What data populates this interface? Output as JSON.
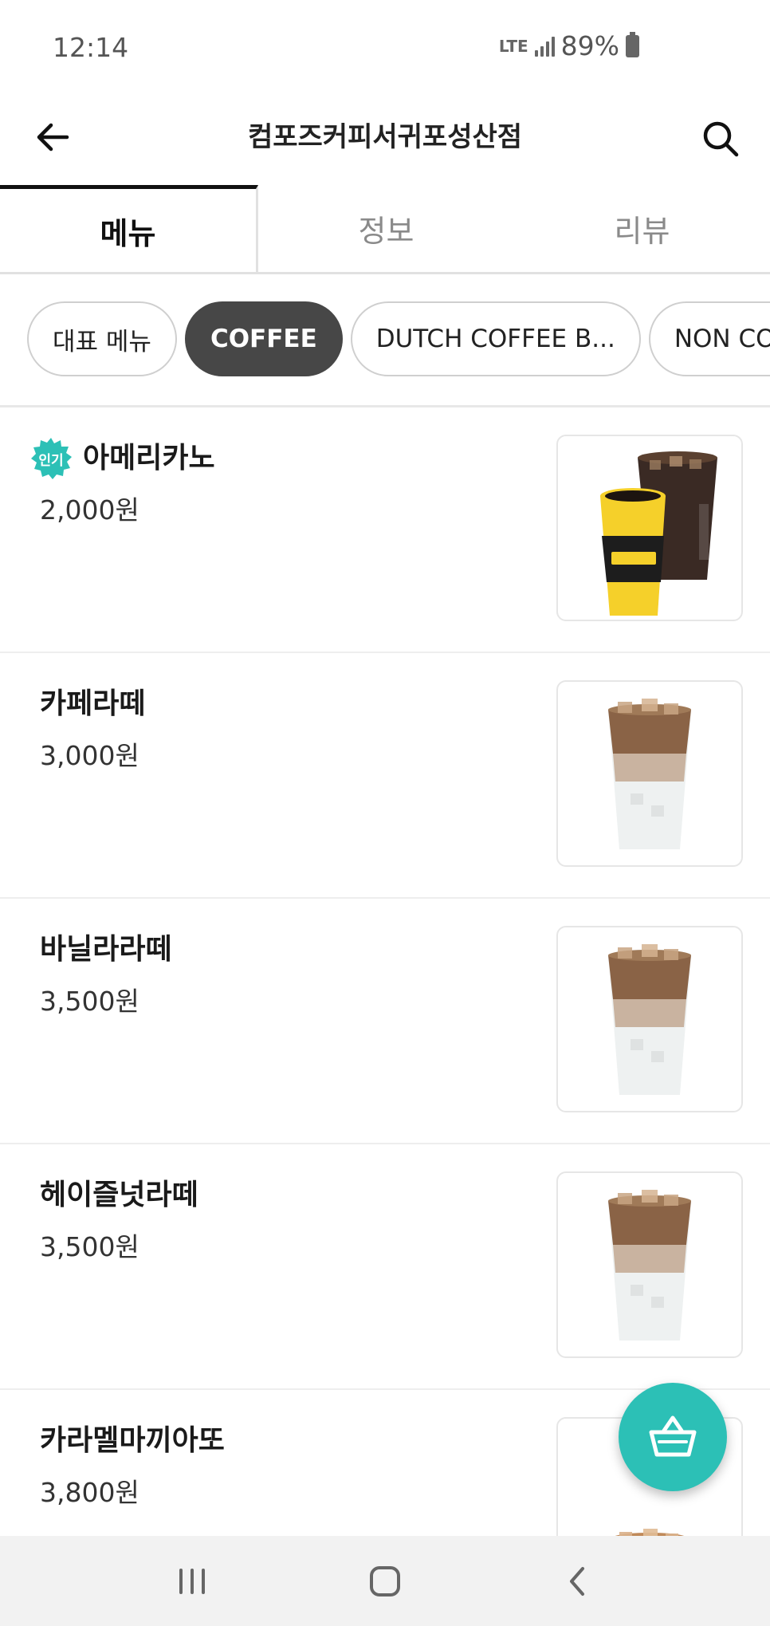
{
  "status_bar": {
    "time": "12:14",
    "network": "LTE",
    "battery": "89%"
  },
  "header": {
    "title": "컴포즈커피서귀포성산점",
    "back_icon": "arrow-left-icon",
    "search_icon": "search-icon"
  },
  "tabs": [
    {
      "label": "메뉴",
      "active": true
    },
    {
      "label": "정보",
      "active": false
    },
    {
      "label": "리뷰",
      "active": false
    }
  ],
  "categories": [
    {
      "label": "대표 메뉴",
      "active": false
    },
    {
      "label": "COFFEE",
      "active": true
    },
    {
      "label": "DUTCH COFFEE B...",
      "active": false
    },
    {
      "label": "NON COFFEE",
      "active": false
    }
  ],
  "menu_items": [
    {
      "name": "아메리카노",
      "price": "2,000원",
      "badge": "인기",
      "image": "americano"
    },
    {
      "name": "카페라떼",
      "price": "3,000원",
      "badge": "",
      "image": "latte"
    },
    {
      "name": "바닐라라떼",
      "price": "3,500원",
      "badge": "",
      "image": "latte"
    },
    {
      "name": "헤이즐넛라떼",
      "price": "3,500원",
      "badge": "",
      "image": "latte"
    },
    {
      "name": "카라멜마끼아또",
      "price": "3,800원",
      "badge": "",
      "image": "macchiato"
    }
  ],
  "cart_icon": "basket-icon",
  "colors": {
    "accent": "#2cc0b6",
    "chip_active": "#474747",
    "badge": "#2cc0b6"
  },
  "nav_bar": {
    "recents_icon": "recents-icon",
    "home_icon": "home-icon",
    "back_icon": "back-chevron-icon"
  }
}
